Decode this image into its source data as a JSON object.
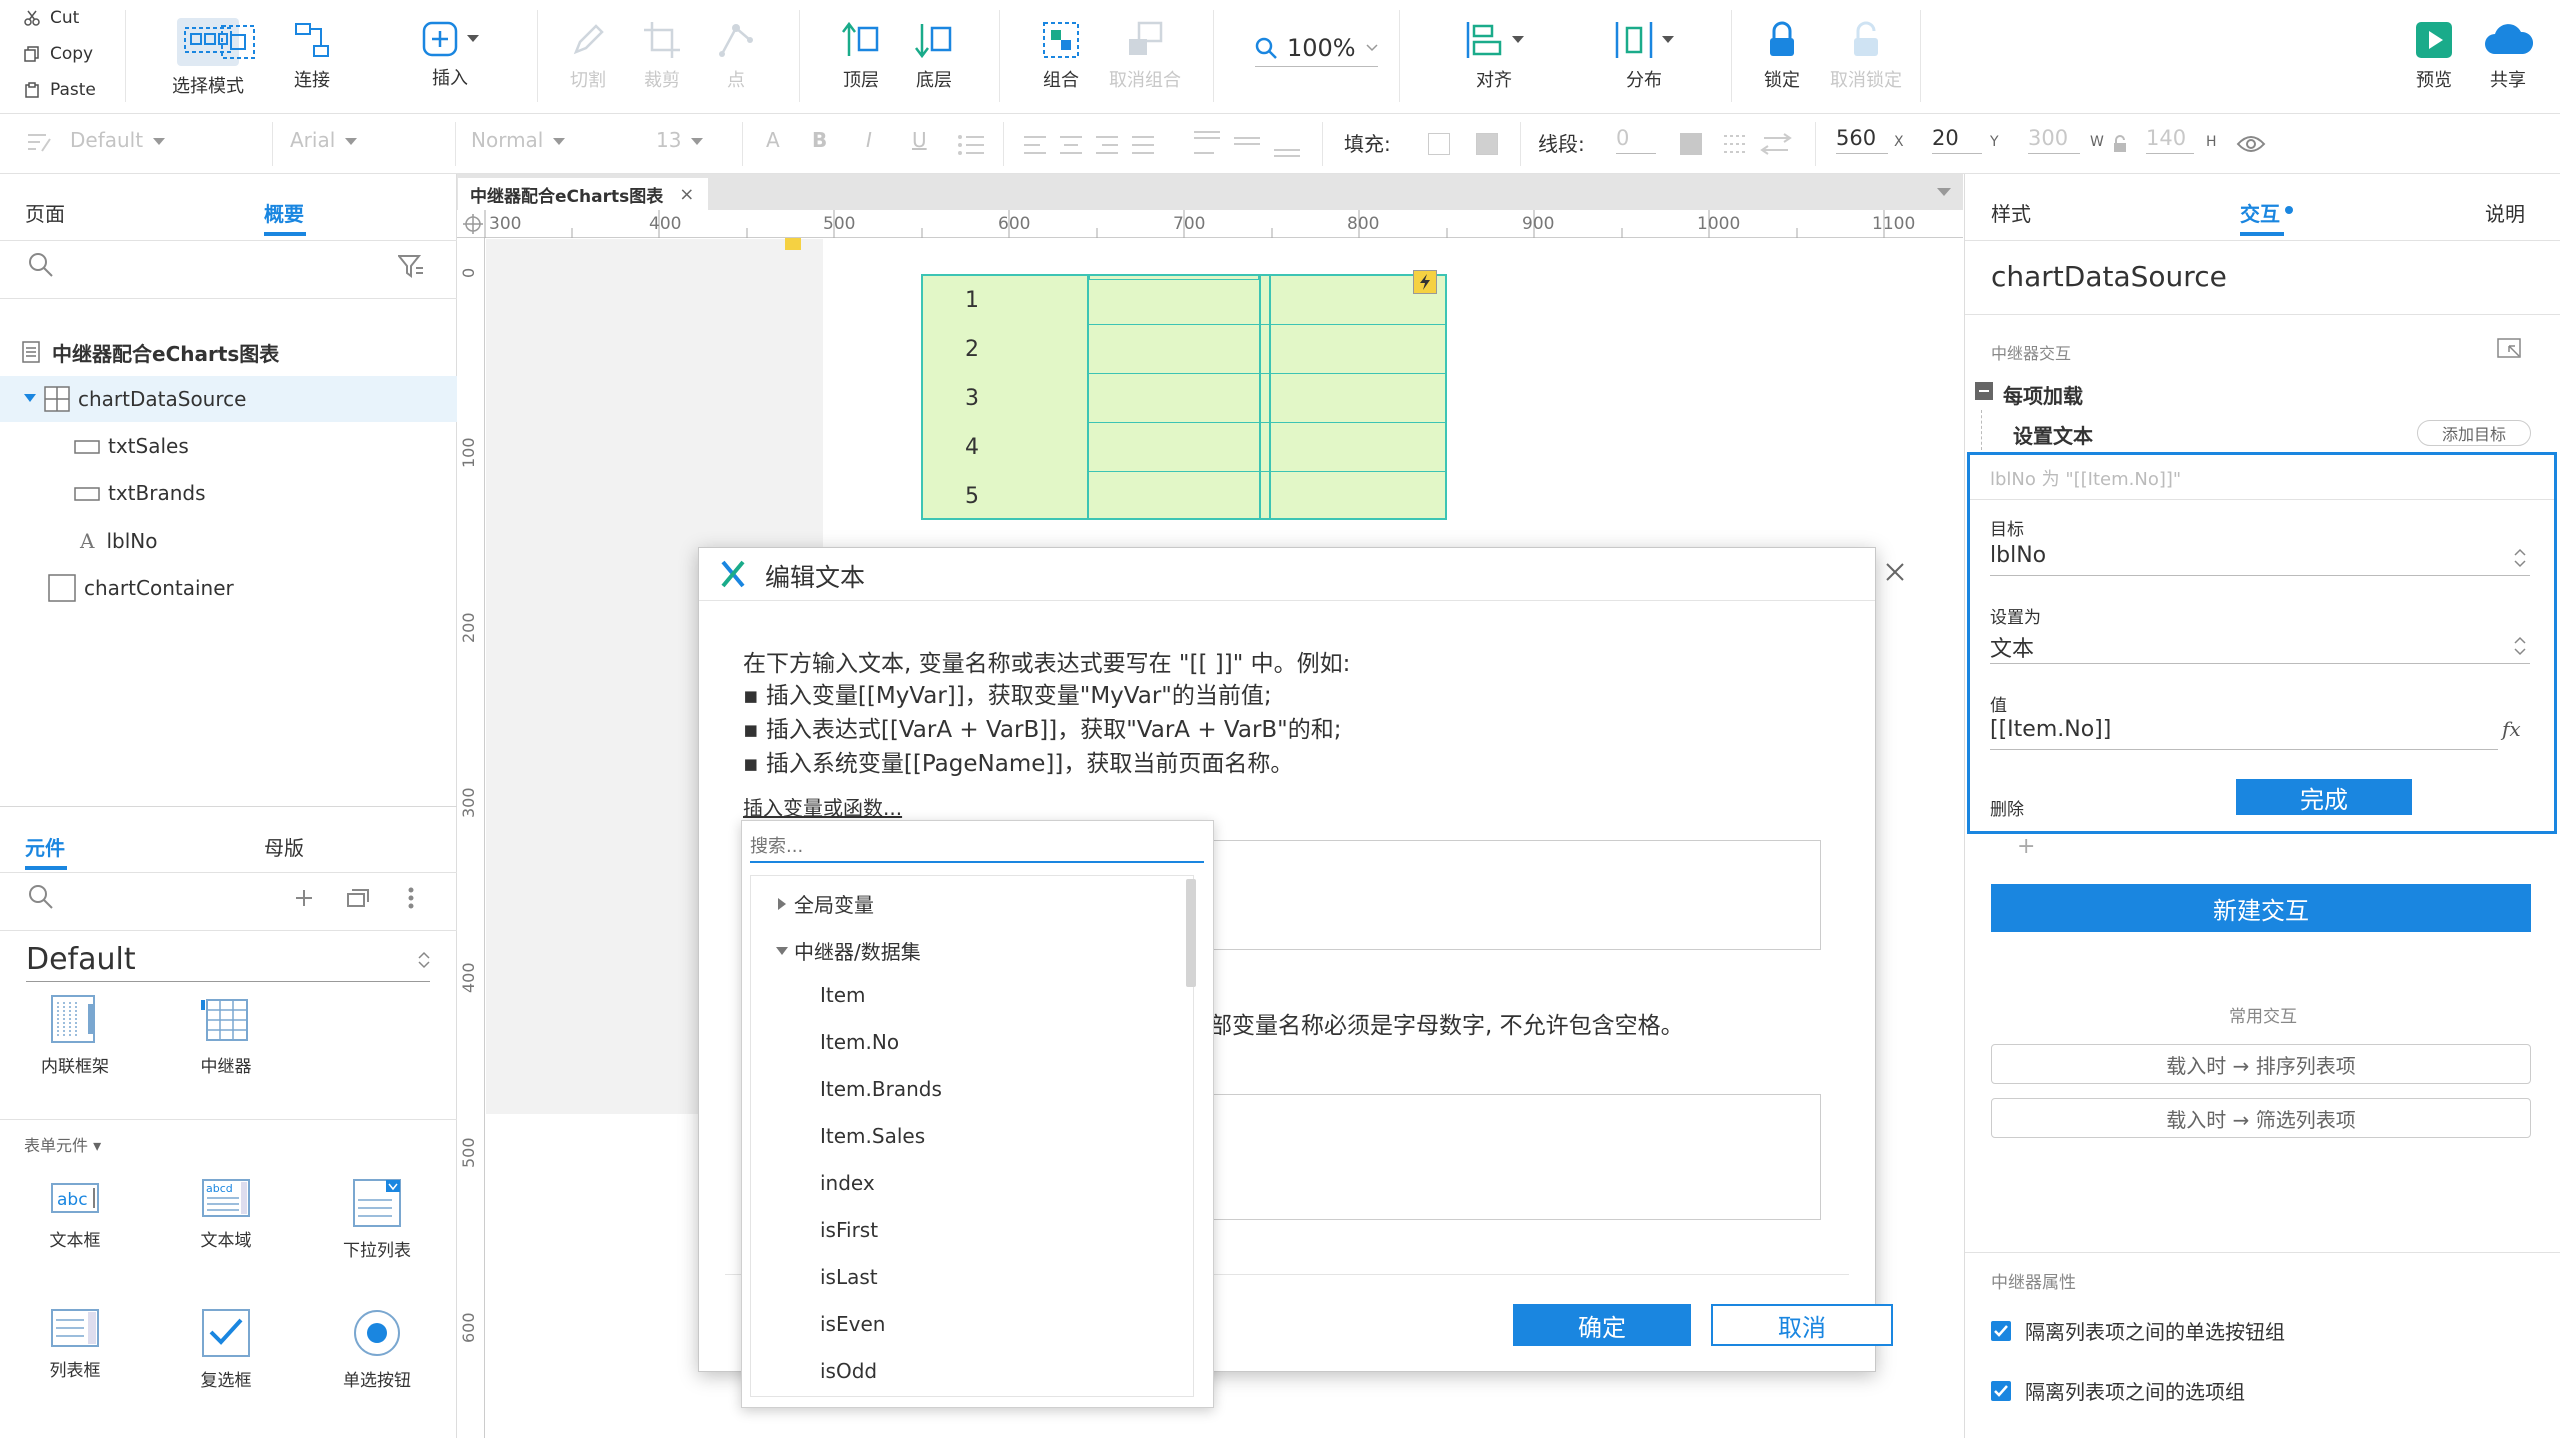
{
  "toolbar": {
    "clipboard": {
      "cut": "Cut",
      "copy": "Copy",
      "paste": "Paste"
    },
    "select_mode": "选择模式",
    "connect": "连接",
    "insert": "插入",
    "cut_shape": "切割",
    "crop": "裁剪",
    "point": "点",
    "top_layer": "顶层",
    "bottom_layer": "底层",
    "group": "组合",
    "ungroup": "取消组合",
    "zoom": "100%",
    "align": "对齐",
    "distribute": "分布",
    "lock": "锁定",
    "unlock": "取消锁定",
    "preview": "预览",
    "share": "共享"
  },
  "format_bar": {
    "style": "Default",
    "font": "Arial",
    "weight": "Normal",
    "size": "13",
    "fill_label": "填充:",
    "line_label": "线段:",
    "line_value": "0",
    "x": "560",
    "x_unit": "X",
    "y": "20",
    "y_unit": "Y",
    "w": "300",
    "w_unit": "W",
    "h": "140",
    "h_unit": "H"
  },
  "left_panel": {
    "tabs": {
      "pages": "页面",
      "outline": "概要"
    },
    "tree": [
      {
        "label": "中继器配合eCharts图表"
      },
      {
        "label": "chartDataSource"
      },
      {
        "label": "txtSales"
      },
      {
        "label": "txtBrands"
      },
      {
        "label": "lblNo"
      },
      {
        "label": "chartContainer"
      }
    ],
    "lib_tabs": {
      "widgets": "元件",
      "masters": "母版"
    },
    "library_name": "Default",
    "lib_row1": [
      {
        "label": "内联框架"
      },
      {
        "label": "中继器"
      }
    ],
    "form_section": "表单元件 ▾",
    "form_row1": [
      {
        "label": "文本框"
      },
      {
        "label": "文本域"
      },
      {
        "label": "下拉列表"
      }
    ],
    "form_row2": [
      {
        "label": "列表框"
      },
      {
        "label": "复选框"
      },
      {
        "label": "单选按钮"
      }
    ]
  },
  "canvas": {
    "tab_title": "中继器配合eCharts图表",
    "ruler_h": [
      "300",
      "400",
      "500",
      "600",
      "700",
      "800",
      "900",
      "1000",
      "1100"
    ],
    "ruler_v": [
      "0",
      "100",
      "200",
      "300",
      "400",
      "500",
      "600"
    ],
    "repeater_rows": [
      "1",
      "2",
      "3",
      "4",
      "5"
    ]
  },
  "dialog": {
    "title": "编辑文本",
    "instruction": "在下方输入文本, 变量名称或表达式要写在 \"[[ ]]\" 中。例如:",
    "bullet1": "▪ 插入变量[[MyVar]]，获取变量\"MyVar\"的当前值;",
    "bullet2": "▪ 插入表达式[[VarA + VarB]]，获取\"VarA + VarB\"的和;",
    "bullet3": "▪ 插入系统变量[[PageName]]，获取当前页面名称。",
    "insert_link": "插入变量或函数...",
    "local_var_note": "部变量名称必须是字母数字, 不允许包含空格。",
    "ok": "确定",
    "cancel": "取消"
  },
  "popup": {
    "search_placeholder": "搜索...",
    "group_global": "全局变量",
    "group_repeater": "中继器/数据集",
    "items": [
      "Item",
      "Item.No",
      "Item.Brands",
      "Item.Sales",
      "index",
      "isFirst",
      "isLast",
      "isEven",
      "isOdd"
    ]
  },
  "right_panel": {
    "tabs": {
      "style": "样式",
      "interaction": "交互",
      "notes": "说明"
    },
    "widget_name": "chartDataSource",
    "section_repeater_interaction": "中继器交互",
    "event": "每项加载",
    "action": "设置文本",
    "add_target": "添加目标",
    "summary": "lblNo 为 \"[[Item.No]]\"",
    "target_label": "目标",
    "target_value": "lblNo",
    "set_to_label": "设置为",
    "set_to_value": "文本",
    "value_label": "值",
    "value_value": "[[Item.No]]",
    "delete": "删除",
    "done": "完成",
    "plus": "+",
    "new_interaction": "新建交互",
    "common_interactions": "常用交互",
    "common1": "载入时 → 排序列表项",
    "common2": "载入时 → 筛选列表项",
    "repeater_props": "中继器属性",
    "prop1": "隔离列表项之间的单选按钮组",
    "prop2": "隔离列表项之间的选项组"
  },
  "colors": {
    "accent": "#1a86e0",
    "repeater_fill": "#e2f7c7",
    "repeater_border": "#3cc4b4",
    "green": "#1aab8a"
  }
}
